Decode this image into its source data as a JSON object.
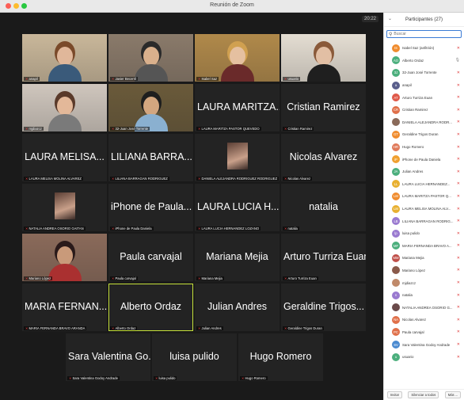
{
  "window": {
    "title": "Reunión de Zoom"
  },
  "clock": "20:22",
  "tiles": [
    {
      "name": "anapil",
      "big": ""
    },
    {
      "name": "Javier Becerril",
      "big": ""
    },
    {
      "name": "Isabel Saz",
      "big": ""
    },
    {
      "name": "usuario",
      "big": ""
    },
    {
      "name": "mjdiazcz",
      "big": ""
    },
    {
      "name": "32-Juan José Torrente",
      "big": ""
    },
    {
      "name": "LAURA MARITZA PASTOR QUEVEDO",
      "big": "LAURA MARITZA..."
    },
    {
      "name": "Cristian Ramirez",
      "big": "Cristian Ramirez"
    },
    {
      "name": "LAURA MELISA MOLINA ALVAREZ",
      "big": "LAURA MELISA..."
    },
    {
      "name": "LILIANA BARRAGAN RODRIGUEZ",
      "big": "LILIANA BARRA..."
    },
    {
      "name": "DANIELA ALEJANDRA RODRIGUEZ RODRIGUEZ",
      "big": ""
    },
    {
      "name": "Nicolas Alvarez",
      "big": "Nicolas Alvarez"
    },
    {
      "name": "NATALIA ANDREA OSORIO GAITAN",
      "big": ""
    },
    {
      "name": "iPhone de Paula Daniela",
      "big": "iPhone de Paula..."
    },
    {
      "name": "LAURA LUCIA HERNANDEZ LOZANO",
      "big": "LAURA LUCIA H..."
    },
    {
      "name": "natalia",
      "big": "natalia"
    },
    {
      "name": "Mariano López",
      "big": ""
    },
    {
      "name": "Paula carvajal",
      "big": "Paula carvajal"
    },
    {
      "name": "Mariana Mejia",
      "big": "Mariana Mejia"
    },
    {
      "name": "Arturo Turriza Euan",
      "big": "Arturo Turriza Euan"
    },
    {
      "name": "MARIA FERNANDA BRAVO ARANDA",
      "big": "MARIA FERNAN..."
    },
    {
      "name": "Alberto Ordaz",
      "big": "Alberto Ordaz"
    },
    {
      "name": "Julian Andres",
      "big": "Julian Andres"
    },
    {
      "name": "Geraldine Trigos Duran",
      "big": "Geraldine Trigos..."
    },
    {
      "name": "Sara Valentina Godoy Andrade",
      "big": "Sara Valentina Go..."
    },
    {
      "name": "luisa pulido",
      "big": "luisa pulido"
    },
    {
      "name": "Hugo Romero",
      "big": "Hugo Romero"
    }
  ],
  "panel": {
    "title": "Participantes (27)",
    "search_placeholder": "Buscar",
    "participants": [
      {
        "initials": "IS",
        "name": "Isabel Saz (anfitrión)",
        "color": "#f08c2e"
      },
      {
        "initials": "AO",
        "name": "Alberto Ordaz",
        "color": "#4caf7d"
      },
      {
        "initials": "3J",
        "name": "32-Juan José Torrente",
        "color": "#4caf7d"
      },
      {
        "initials": "a",
        "name": "anapil",
        "color": "#5a5f8c"
      },
      {
        "initials": "AT",
        "name": "Arturo Turriza Euan",
        "color": "#e05a4a"
      },
      {
        "initials": "CR",
        "name": "Cristian Ramirez",
        "color": "#e0704a"
      },
      {
        "initials": "",
        "name": "DANIELA ALEJANDRA RODR...",
        "color": "#8a6a5a"
      },
      {
        "initials": "GT",
        "name": "Geraldine Trigos Duran",
        "color": "#f08c2e"
      },
      {
        "initials": "HR",
        "name": "Hugo Romero",
        "color": "#e07a5a"
      },
      {
        "initials": "iP",
        "name": "iPhone de Paula Daniela",
        "color": "#f0a030"
      },
      {
        "initials": "JA",
        "name": "Julian Andres",
        "color": "#4caf7d"
      },
      {
        "initials": "LL",
        "name": "LAURA LUCIA HERNANDEZ...",
        "color": "#e8b030"
      },
      {
        "initials": "LM",
        "name": "LAURA MARITZA PASTOR Q...",
        "color": "#f08c2e"
      },
      {
        "initials": "LM",
        "name": "LAURA MELISA MOLINA ALV...",
        "color": "#e8b030"
      },
      {
        "initials": "LB",
        "name": "LILIANA BARRAGAN RODRIG...",
        "color": "#9a7ad0"
      },
      {
        "initials": "lp",
        "name": "luisa pulido",
        "color": "#9a7ad0"
      },
      {
        "initials": "MF",
        "name": "MARIA FERNANDA BRAVO A...",
        "color": "#4caf7d"
      },
      {
        "initials": "MM",
        "name": "Mariana Mejia",
        "color": "#c0504a"
      },
      {
        "initials": "",
        "name": "Mariano López",
        "color": "#8a5a4a"
      },
      {
        "initials": "",
        "name": "mjdiazcz",
        "color": "#c08a6a"
      },
      {
        "initials": "n",
        "name": "natalia",
        "color": "#9a7ad0"
      },
      {
        "initials": "",
        "name": "NATALIA ANDREA OSORIO G...",
        "color": "#6a4a4a"
      },
      {
        "initials": "NA",
        "name": "Nicolas Alvarez",
        "color": "#e0704a"
      },
      {
        "initials": "PC",
        "name": "Paula carvajal",
        "color": "#e0704a"
      },
      {
        "initials": "SV",
        "name": "Sara Valentina Godoy Andrade",
        "color": "#4a8ad0"
      },
      {
        "initials": "u",
        "name": "usuario",
        "color": "#4caf7d"
      }
    ],
    "buttons": {
      "invite": "Invitar",
      "mute_all": "Silenciar a todos",
      "more": "Más ..."
    }
  }
}
